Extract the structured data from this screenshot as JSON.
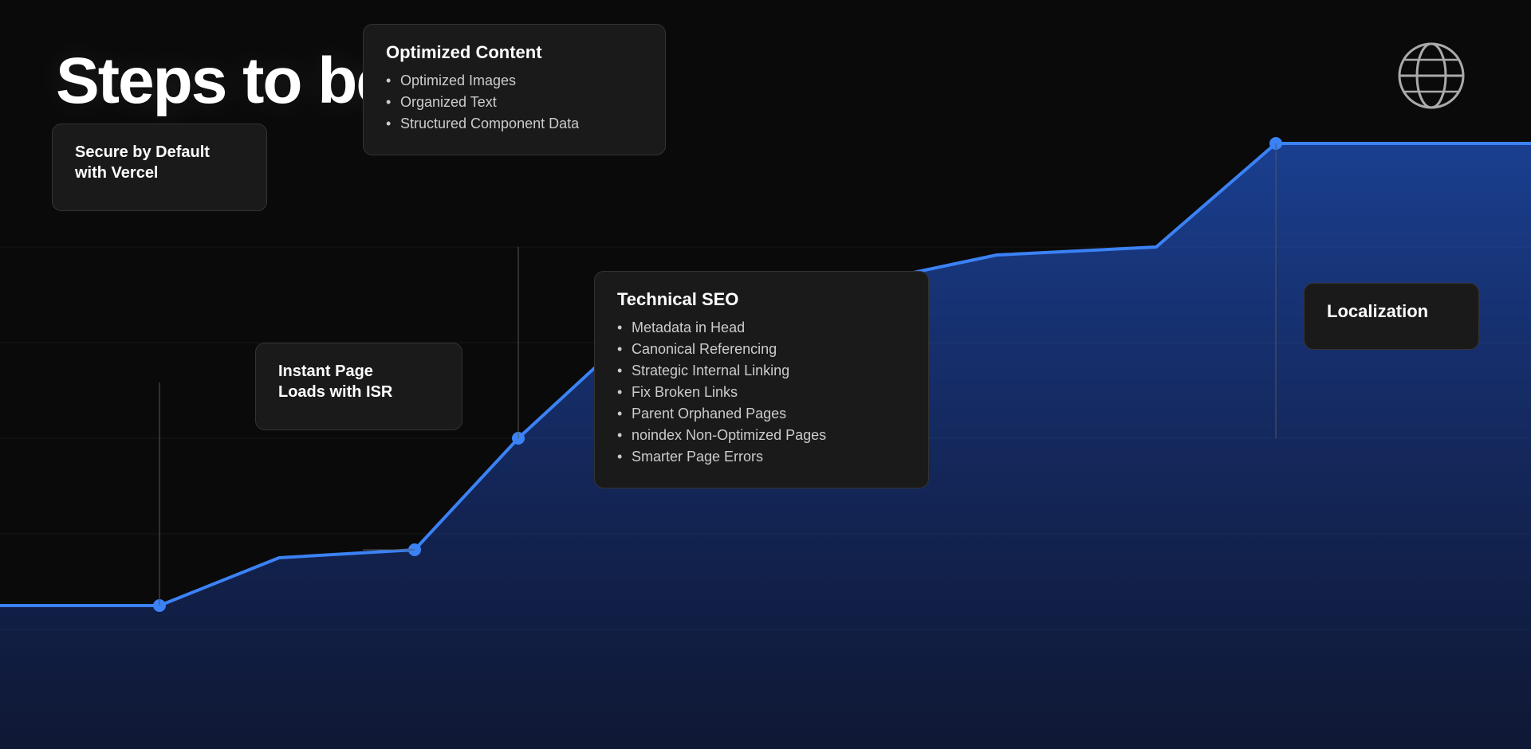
{
  "page": {
    "title": "Steps to better SEO",
    "background_color": "#0a0a0a"
  },
  "cards": {
    "secure": {
      "title": "Secure by Default\nwith Vercel",
      "items": []
    },
    "instant": {
      "title": "Instant Page\nLoads with ISR",
      "items": []
    },
    "optimized": {
      "title": "Optimized Content",
      "items": [
        "Optimized Images",
        "Organized Text",
        "Structured Component Data"
      ]
    },
    "technical": {
      "title": "Technical SEO",
      "items": [
        "Metadata in Head",
        "Canonical Referencing",
        "Strategic Internal Linking",
        "Fix Broken Links",
        "Parent Orphaned Pages",
        "noindex Non-Optimized Pages",
        "Smarter Page Errors"
      ]
    },
    "localization": {
      "title": "Localization",
      "items": []
    }
  },
  "chart": {
    "accent_color": "#2563eb",
    "fill_color": "#1d4ed8"
  }
}
